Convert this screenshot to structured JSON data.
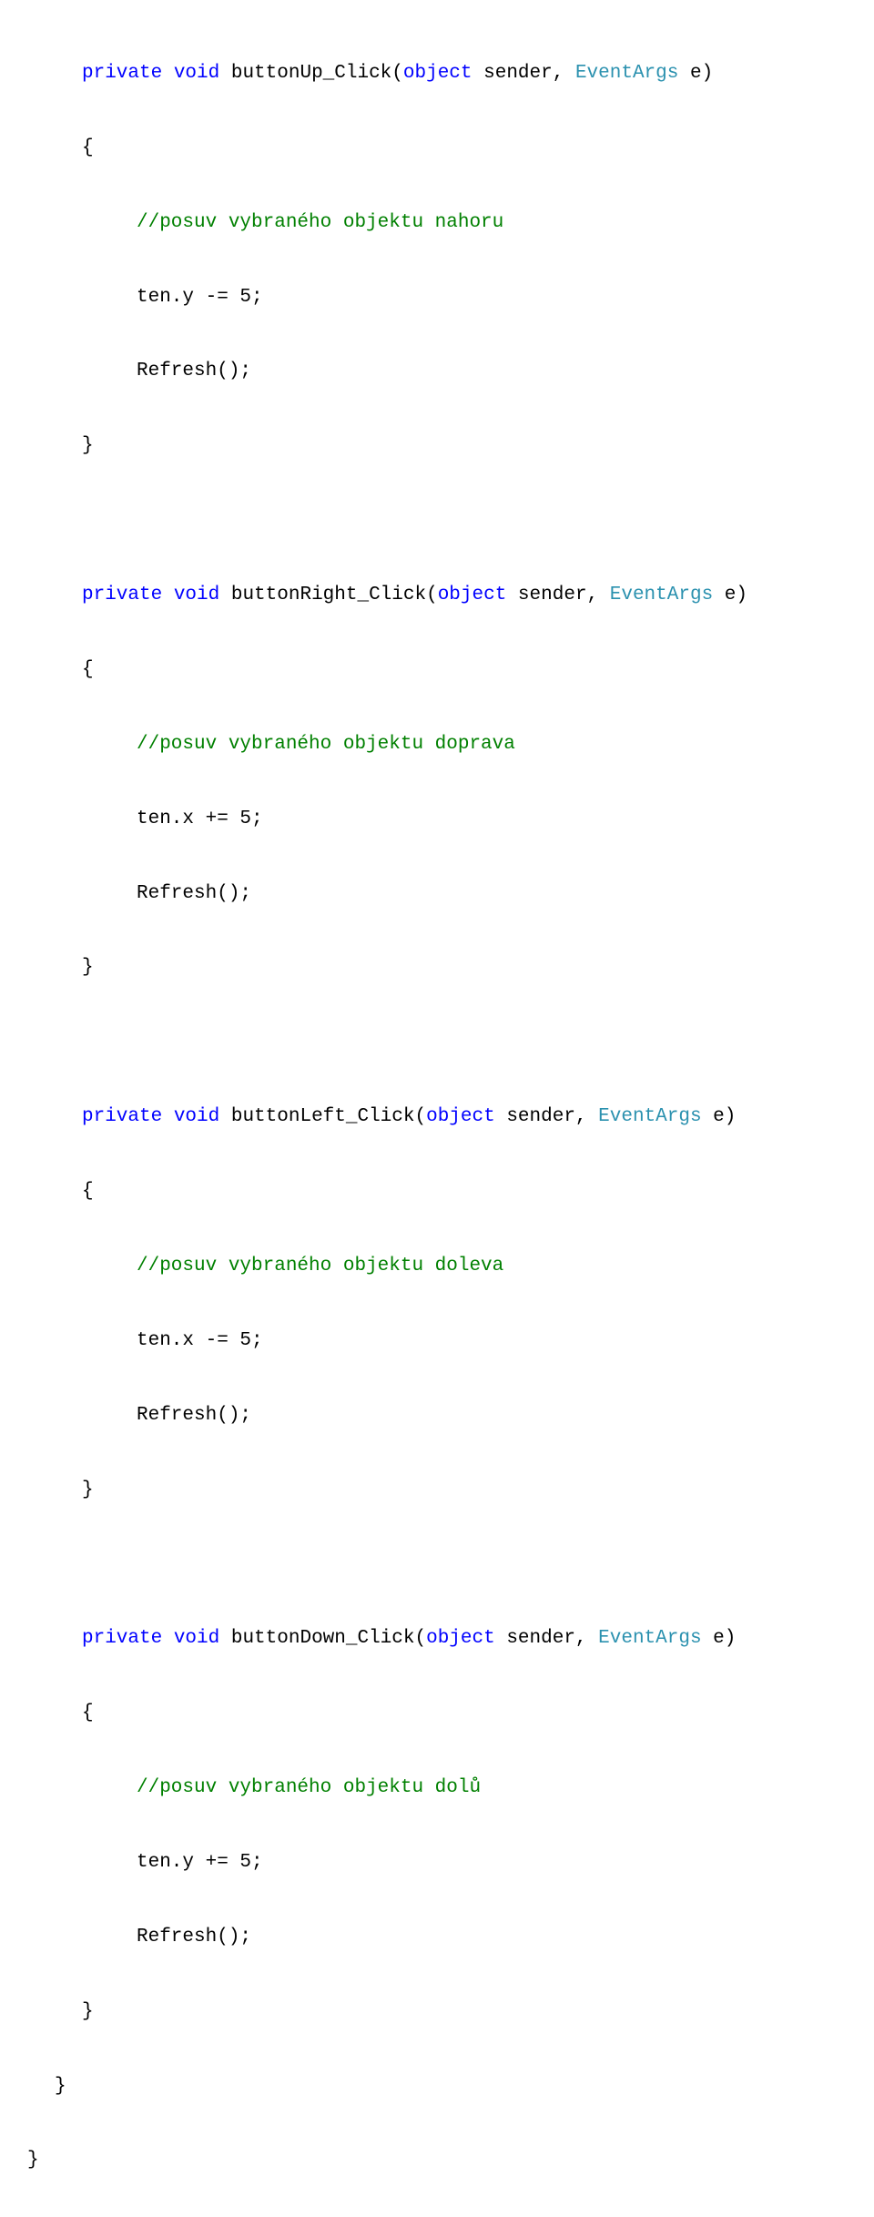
{
  "colors": {
    "keyword": "#0000ff",
    "type": "#2b91af",
    "comment": "#008000",
    "plain": "#000000"
  },
  "methods": {
    "up": {
      "kw_private": "private",
      "kw_void": "void",
      "name": " buttonUp_Click(",
      "kw_object": "object",
      "mid": " sender, ",
      "type_eventargs": "EventArgs",
      "tail": " e)",
      "open": "{",
      "comment": "//posuv vybraného objektu nahoru",
      "stmt1": "ten.y -= 5;",
      "stmt2": "Refresh();",
      "close": "}"
    },
    "right": {
      "kw_private": "private",
      "kw_void": "void",
      "name": " buttonRight_Click(",
      "kw_object": "object",
      "mid": " sender, ",
      "type_eventargs": "EventArgs",
      "tail": " e)",
      "open": "{",
      "comment": "//posuv vybraného objektu doprava",
      "stmt1": "ten.x += 5;",
      "stmt2": "Refresh();",
      "close": "}"
    },
    "left": {
      "kw_private": "private",
      "kw_void": "void",
      "name": " buttonLeft_Click(",
      "kw_object": "object",
      "mid": " sender, ",
      "type_eventargs": "EventArgs",
      "tail": " e)",
      "open": "{",
      "comment": "//posuv vybraného objektu doleva",
      "stmt1": "ten.x -= 5;",
      "stmt2": "Refresh();",
      "close": "}"
    },
    "down": {
      "kw_private": "private",
      "kw_void": "void",
      "name": " buttonDown_Click(",
      "kw_object": "object",
      "mid": " sender, ",
      "type_eventargs": "EventArgs",
      "tail": " e)",
      "open": "{",
      "comment": "//posuv vybraného objektu dolů",
      "stmt1": "ten.y += 5;",
      "stmt2": "Refresh();",
      "close": "}"
    }
  },
  "closing": {
    "brace1": "}",
    "brace0": "}"
  }
}
